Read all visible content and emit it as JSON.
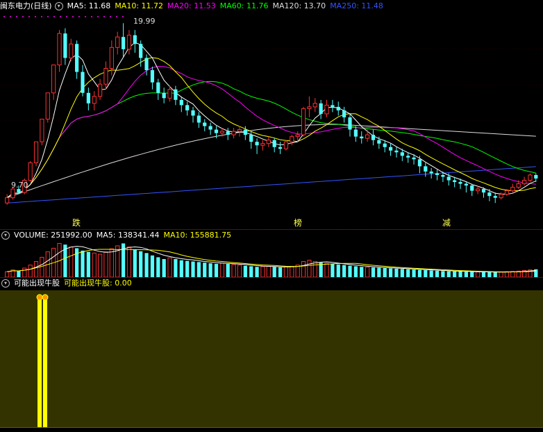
{
  "colors": {
    "ma5": "#ffffff",
    "ma10": "#ffff00",
    "ma20": "#ff00ff",
    "ma60": "#00ff00",
    "ma120": "#dddddd",
    "ma250": "#3355ff",
    "up": "#ff3232",
    "down": "#54ffff",
    "panel": "#333300",
    "signal": "#ffff00"
  },
  "price_panel": {
    "title": "闽东电力(日线)",
    "ma5": "MA5: 11.68",
    "ma10": "MA10: 11.72",
    "ma20": "MA20: 11.53",
    "ma60": "MA60: 11.76",
    "ma120": "MA120: 13.70",
    "ma250": "MA250: 11.48",
    "high_label": "19.99",
    "low_label": "9.70",
    "events": [
      "跌",
      "榜",
      "减"
    ]
  },
  "volume_panel": {
    "title": "VOLUME: 251992.00",
    "ma5": "MA5: 138341.44",
    "ma10": "MA10: 155881.75"
  },
  "signal_panel": {
    "title": "可能出现牛股",
    "value_label": "可能出现牛股: 0.00"
  },
  "chart_data": [
    {
      "type": "candlestick",
      "title": "闽东电力(日线)",
      "series": [
        {
          "name": "MA5",
          "value": 11.68
        },
        {
          "name": "MA10",
          "value": 11.72
        },
        {
          "name": "MA20",
          "value": 11.53
        },
        {
          "name": "MA60",
          "value": 11.76
        },
        {
          "name": "MA120",
          "value": 13.7
        },
        {
          "name": "MA250",
          "value": 11.48
        }
      ],
      "annotations": [
        "19.99",
        "9.70",
        "跌",
        "榜",
        "减"
      ],
      "ylim": [
        8.2,
        20.6
      ],
      "candles": [
        [
          9.7,
          10.0,
          9.6,
          10.2
        ],
        [
          10.0,
          10.5,
          9.9,
          10.6
        ],
        [
          10.5,
          10.3,
          10.2,
          10.7
        ],
        [
          10.3,
          11.0,
          10.2,
          11.1
        ],
        [
          11.0,
          12.0,
          10.9,
          12.1
        ],
        [
          12.0,
          13.2,
          11.8,
          13.2
        ],
        [
          13.2,
          14.5,
          13.0,
          14.5
        ],
        [
          14.5,
          16.0,
          14.3,
          16.0
        ],
        [
          16.0,
          17.6,
          15.6,
          17.6
        ],
        [
          17.6,
          19.4,
          17.2,
          19.6
        ],
        [
          19.4,
          18.0,
          17.6,
          19.7
        ],
        [
          18.0,
          18.8,
          17.8,
          19.1
        ],
        [
          18.8,
          17.2,
          16.8,
          19.0
        ],
        [
          17.2,
          16.0,
          15.8,
          17.6
        ],
        [
          16.0,
          15.4,
          15.0,
          16.3
        ],
        [
          15.4,
          15.8,
          15.0,
          16.1
        ],
        [
          15.8,
          16.5,
          15.6,
          16.8
        ],
        [
          16.5,
          17.4,
          16.2,
          17.8
        ],
        [
          17.4,
          18.6,
          17.0,
          19.0
        ],
        [
          18.6,
          19.2,
          18.2,
          19.5
        ],
        [
          19.2,
          18.5,
          18.0,
          19.99
        ],
        [
          18.5,
          19.3,
          18.2,
          19.6
        ],
        [
          19.3,
          18.8,
          18.3,
          19.6
        ],
        [
          18.8,
          18.0,
          17.5,
          19.0
        ],
        [
          18.0,
          17.3,
          17.0,
          18.2
        ],
        [
          17.3,
          16.6,
          16.2,
          17.5
        ],
        [
          16.6,
          16.0,
          15.6,
          16.8
        ],
        [
          16.0,
          15.7,
          15.4,
          16.3
        ],
        [
          15.7,
          16.2,
          15.5,
          16.4
        ],
        [
          16.2,
          15.6,
          15.3,
          16.4
        ],
        [
          15.6,
          15.3,
          14.9,
          15.8
        ],
        [
          15.3,
          15.0,
          14.7,
          15.5
        ],
        [
          15.0,
          14.7,
          14.3,
          15.2
        ],
        [
          14.7,
          14.3,
          14.0,
          14.9
        ],
        [
          14.3,
          14.1,
          13.8,
          14.5
        ],
        [
          14.1,
          13.9,
          13.6,
          14.3
        ],
        [
          13.9,
          13.7,
          13.4,
          14.1
        ],
        [
          13.7,
          13.8,
          13.5,
          14.0
        ],
        [
          13.8,
          13.6,
          13.3,
          14.0
        ],
        [
          13.6,
          13.8,
          13.4,
          14.0
        ],
        [
          13.8,
          13.9,
          13.5,
          14.1
        ],
        [
          13.9,
          13.6,
          13.3,
          14.1
        ],
        [
          13.6,
          13.2,
          12.8,
          13.8
        ],
        [
          13.2,
          13.0,
          12.5,
          13.4
        ],
        [
          13.0,
          13.1,
          12.7,
          13.3
        ],
        [
          13.1,
          13.3,
          12.9,
          13.5
        ],
        [
          13.3,
          12.9,
          12.6,
          13.4
        ],
        [
          12.9,
          12.8,
          12.5,
          13.2
        ],
        [
          12.8,
          13.2,
          12.7,
          13.3
        ],
        [
          13.2,
          13.5,
          13.0,
          13.6
        ],
        [
          13.5,
          13.6,
          13.2,
          13.8
        ],
        [
          13.6,
          15.1,
          13.5,
          15.2
        ],
        [
          15.1,
          15.2,
          14.6,
          15.8
        ],
        [
          15.2,
          15.4,
          14.9,
          15.7
        ],
        [
          15.4,
          14.8,
          14.5,
          15.6
        ],
        [
          14.8,
          15.3,
          14.6,
          15.6
        ],
        [
          15.3,
          15.2,
          14.9,
          15.6
        ],
        [
          15.2,
          15.0,
          14.7,
          15.5
        ],
        [
          15.0,
          14.6,
          14.3,
          15.2
        ],
        [
          14.6,
          13.9,
          13.5,
          14.8
        ],
        [
          13.9,
          13.5,
          13.2,
          14.1
        ],
        [
          13.5,
          13.4,
          13.1,
          13.8
        ],
        [
          13.4,
          13.6,
          13.2,
          13.9
        ],
        [
          13.6,
          13.3,
          13.0,
          13.9
        ],
        [
          13.3,
          13.1,
          12.8,
          13.5
        ],
        [
          13.1,
          12.9,
          12.6,
          13.3
        ],
        [
          12.9,
          12.7,
          12.4,
          13.1
        ],
        [
          12.7,
          12.6,
          12.3,
          12.9
        ],
        [
          12.6,
          12.4,
          12.1,
          12.8
        ],
        [
          12.4,
          12.3,
          12.0,
          12.6
        ],
        [
          12.3,
          12.2,
          11.9,
          12.5
        ],
        [
          12.2,
          11.8,
          11.4,
          12.4
        ],
        [
          11.8,
          11.5,
          11.2,
          12.0
        ],
        [
          11.5,
          11.4,
          11.1,
          11.7
        ],
        [
          11.4,
          11.3,
          11.0,
          11.6
        ],
        [
          11.3,
          11.2,
          10.9,
          11.5
        ],
        [
          11.2,
          11.0,
          10.7,
          11.4
        ],
        [
          11.0,
          10.9,
          10.6,
          11.2
        ],
        [
          10.9,
          10.8,
          10.5,
          11.1
        ],
        [
          10.8,
          10.7,
          10.3,
          10.9
        ],
        [
          10.7,
          10.4,
          10.1,
          10.8
        ],
        [
          10.4,
          10.5,
          10.2,
          10.7
        ],
        [
          10.5,
          10.3,
          10.0,
          10.6
        ],
        [
          10.3,
          10.1,
          9.8,
          10.5
        ],
        [
          10.1,
          10.0,
          9.7,
          10.3
        ],
        [
          10.0,
          10.2,
          9.9,
          10.3
        ],
        [
          10.2,
          10.4,
          10.1,
          10.5
        ],
        [
          10.4,
          10.6,
          10.3,
          10.8
        ],
        [
          10.6,
          10.8,
          10.5,
          11.0
        ],
        [
          10.8,
          11.0,
          10.7,
          11.2
        ],
        [
          11.0,
          11.3,
          10.9,
          11.4
        ],
        [
          11.3,
          11.1,
          10.9,
          11.4
        ]
      ]
    },
    {
      "type": "bar",
      "title": "VOLUME: 251992.00",
      "series": [
        {
          "name": "MA5",
          "value": 138341.44
        },
        {
          "name": "MA10",
          "value": 155881.75
        }
      ],
      "ylim": [
        0,
        600000
      ],
      "values": [
        90000,
        120000,
        100000,
        150000,
        200000,
        260000,
        330000,
        420000,
        480000,
        560000,
        540000,
        500000,
        480000,
        440000,
        420000,
        400000,
        380000,
        420000,
        470000,
        520000,
        560000,
        500000,
        460000,
        430000,
        400000,
        360000,
        330000,
        300000,
        320000,
        300000,
        280000,
        270000,
        260000,
        250000,
        240000,
        230000,
        220000,
        230000,
        220000,
        210000,
        200000,
        190000,
        180000,
        170000,
        175000,
        180000,
        170000,
        160000,
        170000,
        180000,
        200000,
        260000,
        280000,
        260000,
        240000,
        230000,
        220000,
        210000,
        200000,
        190000,
        180000,
        170000,
        165000,
        160000,
        155000,
        150000,
        145000,
        140000,
        135000,
        130000,
        125000,
        120000,
        115000,
        110000,
        105000,
        100000,
        98000,
        95000,
        92000,
        90000,
        88000,
        86000,
        84000,
        82000,
        80000,
        85000,
        90000,
        95000,
        100000,
        110000,
        120000,
        130000
      ]
    },
    {
      "type": "bar",
      "title": "可能出现牛股",
      "series": [
        {
          "name": "可能出现牛股",
          "value": 0.0
        }
      ],
      "ylim": [
        0,
        1
      ],
      "values": [
        0,
        0,
        0,
        0,
        0,
        0,
        0,
        0,
        0,
        1,
        1,
        0
      ]
    }
  ]
}
